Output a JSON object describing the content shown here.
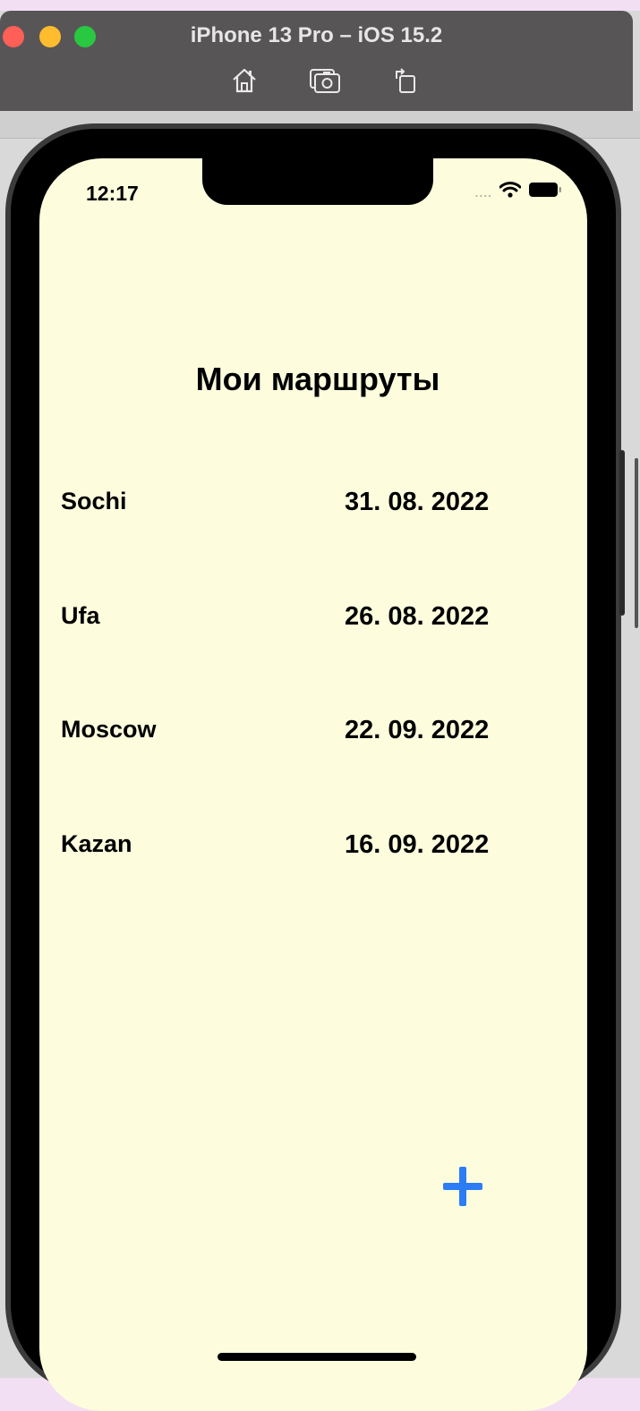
{
  "simulator": {
    "title": "iPhone 13 Pro – iOS 15.2",
    "toolbar": [
      {
        "icon": "home-icon"
      },
      {
        "icon": "screenshot-icon"
      },
      {
        "icon": "rotate-icon"
      }
    ]
  },
  "status_bar": {
    "time": "12:17",
    "signal": "....",
    "icons": [
      "wifi-icon",
      "battery-icon"
    ]
  },
  "screen": {
    "title": "Мои маршруты",
    "background": "#fdfdde",
    "routes": [
      {
        "city": "Sochi",
        "date": "31. 08. 2022"
      },
      {
        "city": "Ufa",
        "date": "26. 08. 2022"
      },
      {
        "city": "Moscow",
        "date": "22. 09. 2022"
      },
      {
        "city": "Kazan",
        "date": "16. 09. 2022"
      }
    ],
    "add_button": {
      "icon": "plus-icon",
      "color": "#2c7cf6"
    }
  }
}
